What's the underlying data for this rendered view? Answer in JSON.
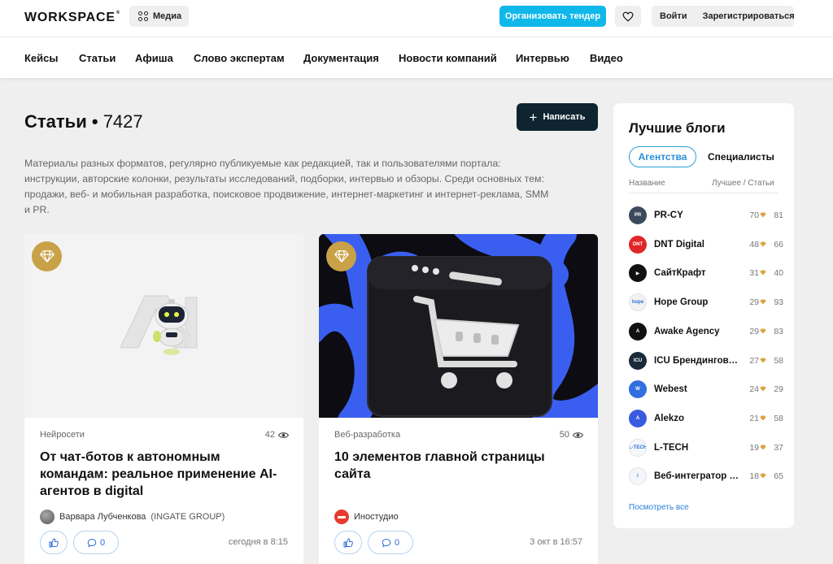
{
  "header": {
    "logo": "WORKSPACE",
    "logo_mark": "®",
    "media_label": "Медиа",
    "tender_label": "Организовать тендер",
    "login_label": "Войти",
    "register_label": "Зарегистрироваться"
  },
  "nav": [
    "Кейсы",
    "Статьи",
    "Афиша",
    "Слово экспертам",
    "Документация",
    "Новости компаний",
    "Интервью",
    "Видео"
  ],
  "page": {
    "title": "Статьи",
    "separator": "•",
    "count": "7427",
    "write_label": "Написать",
    "description": "Материалы разных форматов, регулярно публикуемые как редакцией, так и пользователями портала: инструкции, авторские колонки, результаты исследований, подборки, интервью и обзоры. Среди основных тем: продажи, веб- и мобильная разработка, поисковое продвижение, интернет-маркетинг и интернет-реклама, SMM и PR."
  },
  "cards": [
    {
      "category": "Нейросети",
      "views": "42",
      "title": "От чат-ботов к автономным командам: реальное применение AI-агентов в digital",
      "author": "Варвара Лубченкова",
      "company": "(INGATE GROUP)",
      "likes": "",
      "comments": "0",
      "date": "сегодня в 8:15"
    },
    {
      "category": "Веб-разработка",
      "views": "50",
      "title": "10 элементов главной страницы сайта",
      "author": "Иностудио",
      "company": "",
      "likes": "",
      "comments": "0",
      "date": "3 окт в 16:57"
    }
  ],
  "sidebar": {
    "title": "Лучшие блоги",
    "tab_agencies": "Агентства",
    "tab_specialists": "Специалисты",
    "col_name": "Название",
    "col_stats": "Лучшее / Статьи",
    "see_all": "Посмотреть все",
    "items": [
      {
        "name": "PR-CY",
        "best": "70",
        "articles": "81",
        "color": "#3c4a5c"
      },
      {
        "name": "DNT Digital",
        "best": "48",
        "articles": "66",
        "color": "#e02626"
      },
      {
        "name": "СайтКрафт",
        "best": "31",
        "articles": "40",
        "color": "#111111"
      },
      {
        "name": "Hope Group",
        "best": "29",
        "articles": "93",
        "color": "#f2f2f2"
      },
      {
        "name": "Awake Agency",
        "best": "29",
        "articles": "83",
        "color": "#111111"
      },
      {
        "name": "ICU Брендинговое агентство",
        "best": "27",
        "articles": "58",
        "color": "#1b2a3a"
      },
      {
        "name": "Webest",
        "best": "24",
        "articles": "29",
        "color": "#2f6fe0"
      },
      {
        "name": "Alekzo",
        "best": "21",
        "articles": "58",
        "color": "#3a5be0"
      },
      {
        "name": "L-TECH",
        "best": "19",
        "articles": "37",
        "color": "#f5f7fb"
      },
      {
        "name": "Веб-интегратор ИНТЕРВОЛГА",
        "best": "18",
        "articles": "65",
        "color": "#f3f6fa"
      }
    ]
  },
  "colors": {
    "accent": "#10b8ea",
    "dark_button": "#0e2531",
    "badge_gold": "#c9a147",
    "link_blue": "#2a7fd8"
  }
}
